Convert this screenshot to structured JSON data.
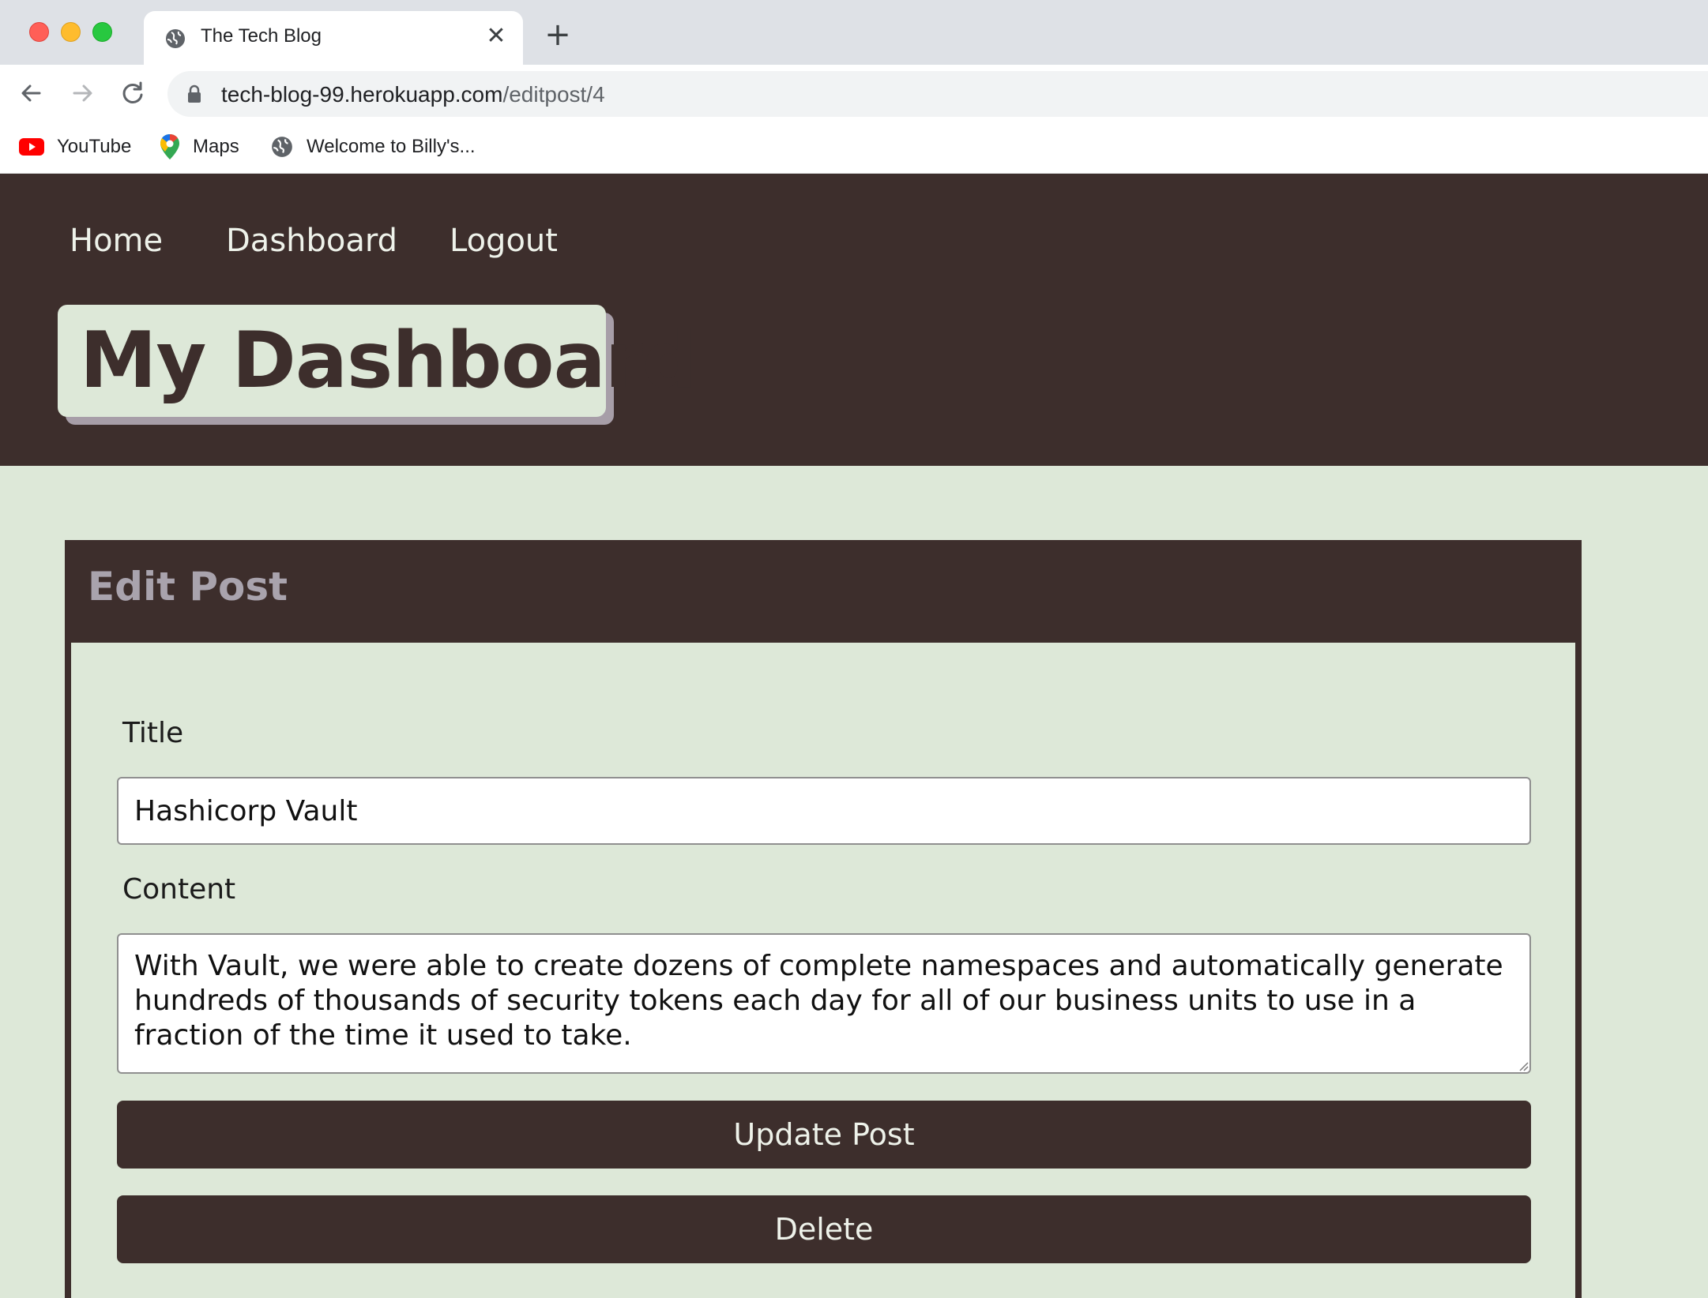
{
  "browser": {
    "tab": {
      "title": "The Tech Blog",
      "icon": "globe-icon"
    },
    "url": {
      "host": "tech-blog-99.herokuapp.com",
      "path": "/editpost/4"
    },
    "bookmarks": [
      {
        "label": "YouTube",
        "icon": "youtube-icon"
      },
      {
        "label": "Maps",
        "icon": "maps-icon"
      },
      {
        "label": "Welcome to Billy's...",
        "icon": "globe-icon"
      }
    ]
  },
  "nav": {
    "links": [
      {
        "label": "Home"
      },
      {
        "label": "Dashboard"
      },
      {
        "label": "Logout"
      }
    ]
  },
  "header": {
    "title": "My Dashboard"
  },
  "edit_post": {
    "heading": "Edit Post",
    "title_label": "Title",
    "title_value": "Hashicorp Vault",
    "content_label": "Content",
    "content_value": "With Vault, we were able to create dozens of complete namespaces and automatically generate hundreds of thousands of security tokens each day for all of our business units to use in a fraction of the time it used to take.",
    "update_button": "Update Post",
    "delete_button": "Delete"
  },
  "colors": {
    "header_bg": "#3d2e2c",
    "page_bg": "#dde8d8",
    "title_shadow": "#a79ea8",
    "card_heading": "#a9a3ad"
  }
}
